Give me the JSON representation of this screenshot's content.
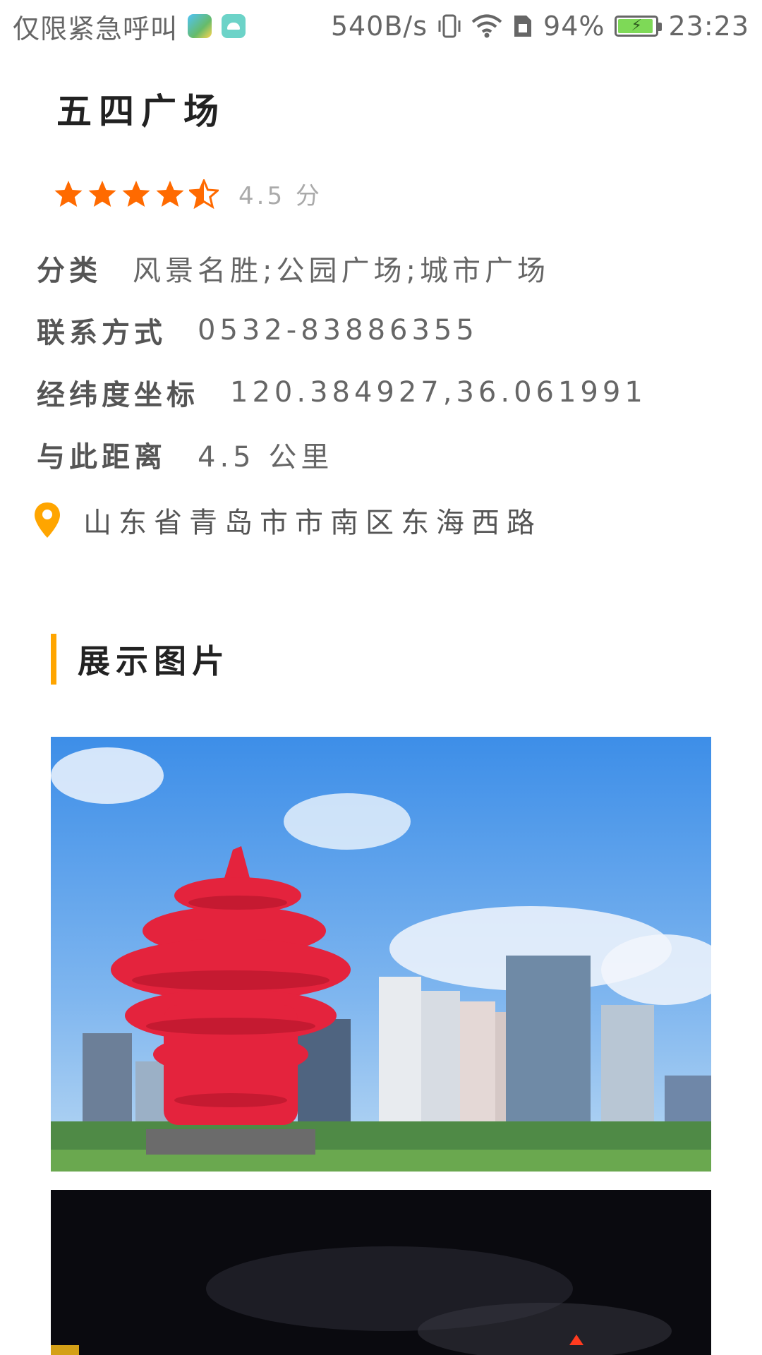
{
  "status_bar": {
    "carrier": "仅限紧急呼叫",
    "net_speed": "540B/s",
    "battery": "94%",
    "battery_level": 0.94,
    "time": "23:23",
    "icons": [
      "map-app-icon",
      "android-app-icon",
      "vibrate-icon",
      "wifi-icon",
      "sim-icon",
      "battery-icon"
    ]
  },
  "place": {
    "title": "五四广场",
    "rating_value": 4.5,
    "rating_text": "4.5 分"
  },
  "info": {
    "category_label": "分类",
    "category_value": "风景名胜;公园广场;城市广场",
    "contact_label": "联系方式",
    "contact_value": "0532-83886355",
    "coords_label": "经纬度坐标",
    "coords_value": "120.384927,36.061991",
    "distance_label": "与此距离",
    "distance_value": "4.5 公里"
  },
  "address": {
    "icon": "location-pin-icon",
    "text": "山东省青岛市市南区东海西路"
  },
  "gallery": {
    "title": "展示图片",
    "accent_color": "#ffa500"
  },
  "colors": {
    "star": "#ff6a00",
    "pin": "#ffa500"
  }
}
